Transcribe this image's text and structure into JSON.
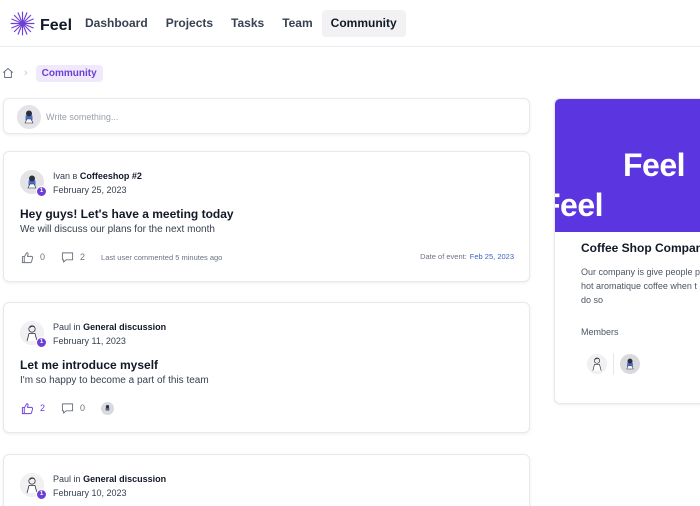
{
  "app": {
    "name": "Feel"
  },
  "nav": {
    "items": [
      {
        "label": "Dashboard"
      },
      {
        "label": "Projects"
      },
      {
        "label": "Tasks"
      },
      {
        "label": "Team"
      },
      {
        "label": "Community",
        "active": true
      }
    ]
  },
  "breadcrumb": {
    "current": "Community"
  },
  "composer": {
    "placeholder": "Write something..."
  },
  "posts": [
    {
      "author": "Ivan",
      "connector": "в",
      "group": "Coffeeshop #2",
      "date": "February 25, 2023",
      "badge": "1",
      "title": "Hey guys! Let's have a meeting today",
      "body": "We will discuss our plans for the next month",
      "likes": "0",
      "comments": "2",
      "last_comment": "Last user commented 5 minutes ago",
      "event_label": "Date of event:",
      "event_date": "Feb 25, 2023"
    },
    {
      "author": "Paul",
      "connector": "in",
      "group": "General discussion",
      "date": "February 11, 2023",
      "badge": "1",
      "title": "Let me introduce myself",
      "body": "I'm so happy to become a part of this team",
      "likes": "2",
      "comments": "0"
    },
    {
      "author": "Paul",
      "connector": "in",
      "group": "General discussion",
      "date": "February 10, 2023",
      "badge": "1"
    }
  ],
  "group": {
    "banner_word_1": "Feel",
    "banner_word_2": "Feel",
    "name": "Coffee Shop Company",
    "desc_lines": [
      "Our company is give people p",
      "hot aromatique coffee when t",
      "do so"
    ],
    "members_label": "Members"
  },
  "colors": {
    "accent": "#6d3fd6",
    "banner": "#5b35e0",
    "link": "#3b62c7"
  },
  "icons": {
    "logo": "starburst-icon",
    "home": "home-icon",
    "like": "thumbs-up-icon",
    "comment": "comment-icon"
  }
}
